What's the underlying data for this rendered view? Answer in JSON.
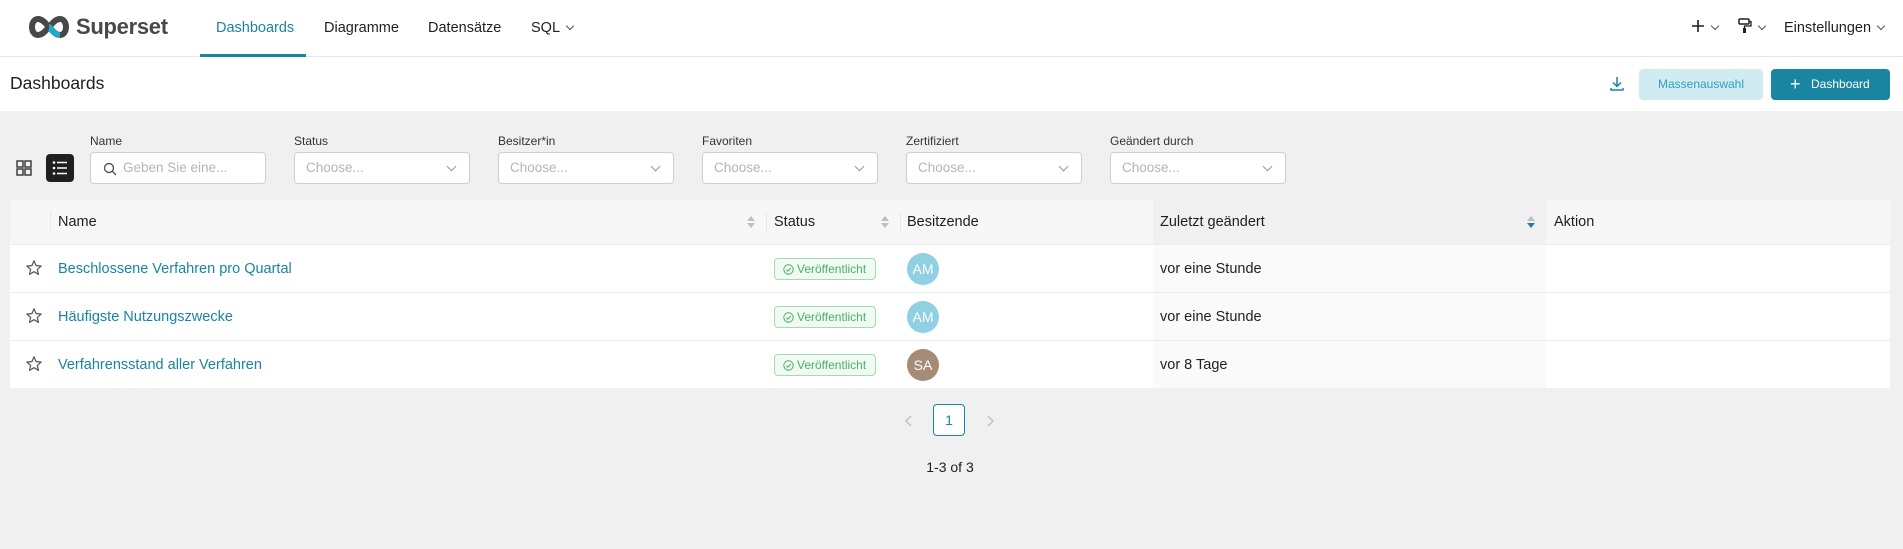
{
  "app": {
    "logo_text": "Superset",
    "brand_color": "#1a85a0"
  },
  "nav": {
    "items": [
      {
        "label": "Dashboards",
        "active": true
      },
      {
        "label": "Diagramme"
      },
      {
        "label": "Datensätze"
      },
      {
        "label": "SQL"
      }
    ],
    "right": {
      "settings_label": "Einstellungen",
      "plus_icon": "plus-icon",
      "theme_icon": "paint-roller-icon"
    }
  },
  "page": {
    "title": "Dashboards",
    "bulk_label": "Massenauswahl",
    "add_label": "Dashboard",
    "download_icon": "download-icon"
  },
  "filters": [
    {
      "label": "Name",
      "placeholder": "Geben Sie eine..."
    },
    {
      "label": "Status",
      "placeholder": "Choose..."
    },
    {
      "label": "Besitzer*in",
      "placeholder": "Choose..."
    },
    {
      "label": "Favoriten",
      "placeholder": "Choose..."
    },
    {
      "label": "Zertifiziert",
      "placeholder": "Choose..."
    },
    {
      "label": "Geändert durch",
      "placeholder": "Choose..."
    }
  ],
  "table": {
    "columns": [
      "Name",
      "Status",
      "Besitzende",
      "Zuletzt geändert",
      "Aktion"
    ],
    "rows": [
      {
        "name": "Beschlossene Verfahren pro Quartal",
        "status": "Veröffentlicht",
        "owner": "AM",
        "owner_color": "#8fd0e2",
        "changed": "vor eine Stunde"
      },
      {
        "name": "Häufigste Nutzungszwecke",
        "status": "Veröffentlicht",
        "owner": "AM",
        "owner_color": "#8fd0e2",
        "changed": "vor eine Stunde"
      },
      {
        "name": "Verfahrensstand aller Verfahren",
        "status": "Veröffentlicht",
        "owner": "SA",
        "owner_color": "#a58c76",
        "changed": "vor 8 Tage"
      }
    ]
  },
  "pagination": {
    "current": "1",
    "summary": "1-3 of 3"
  }
}
